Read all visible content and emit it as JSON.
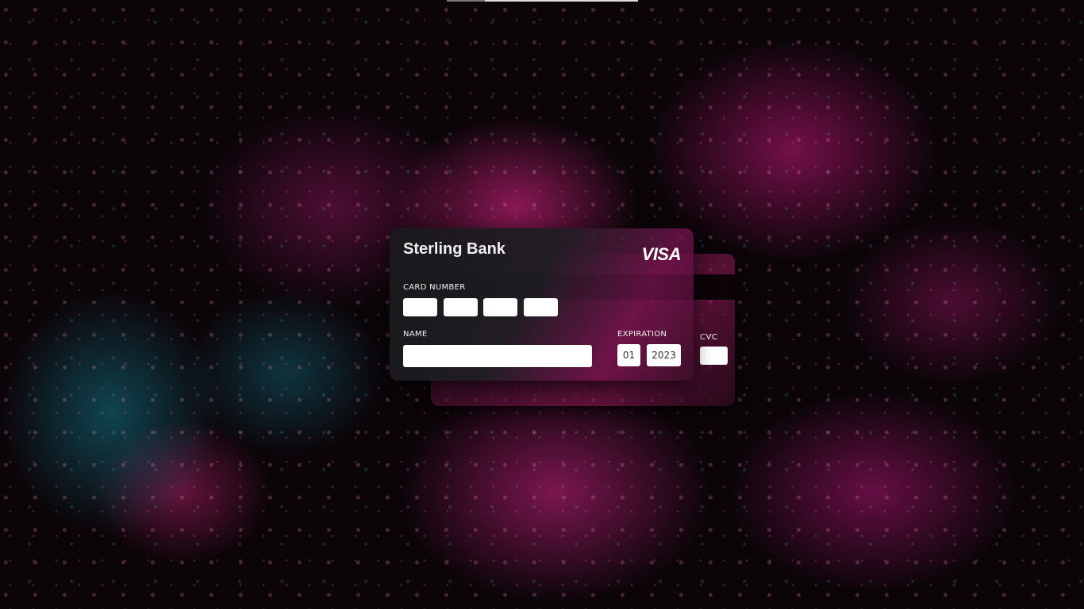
{
  "card": {
    "bank_name": "Sterling Bank",
    "brand": "VISA",
    "card_number_label": "CARD NUMBER",
    "name_label": "NAME",
    "expiration_label": "EXPIRATION",
    "expiration_month": "01",
    "expiration_year": "2023",
    "cvc_label": "CVC"
  },
  "colors": {
    "accent_pink": "#b81e6e",
    "accent_teal": "#1e7a8c"
  }
}
